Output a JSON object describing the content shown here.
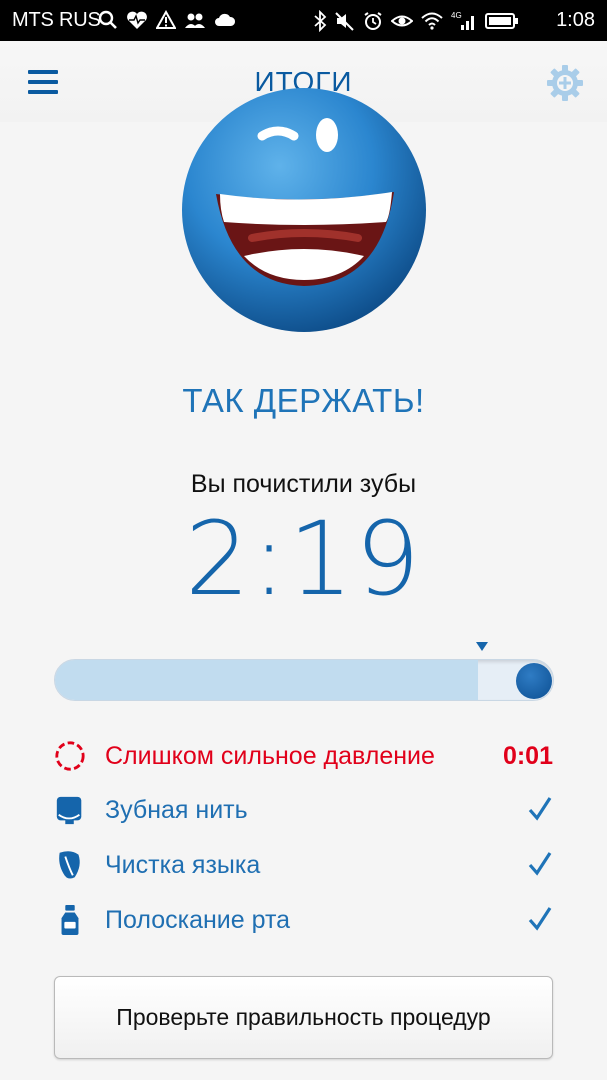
{
  "status_bar": {
    "carrier": "MTS RUS",
    "network_badge": "4G",
    "time": "1:08",
    "left_icons": [
      "search-icon",
      "heart-rate-icon",
      "warning-icon",
      "people-icon",
      "cloud-icon"
    ],
    "right_icons": [
      "bluetooth-icon",
      "mute-icon",
      "alarm-icon",
      "eye-icon",
      "wifi-icon",
      "signal-icon",
      "battery-icon"
    ]
  },
  "header": {
    "title": "ИТОГИ",
    "menu_icon": "hamburger-menu-icon",
    "settings_icon": "gear-add-icon"
  },
  "result": {
    "headline": "ТАК ДЕРЖАТЬ!",
    "subtext": "Вы почистили зубы",
    "time": "2:19",
    "progress_fraction": 0.85,
    "target_marker_fraction": 0.85
  },
  "checklist": [
    {
      "label": "Слишком сильное давление",
      "value": "0:01",
      "icon": "pressure-ring-icon",
      "done": false
    },
    {
      "label": "Зубная нить",
      "value": "",
      "icon": "floss-icon",
      "done": true
    },
    {
      "label": "Чистка языка",
      "value": "",
      "icon": "tongue-icon",
      "done": true
    },
    {
      "label": "Полоскание рта",
      "value": "",
      "icon": "mouthwash-bottle-icon",
      "done": true
    }
  ],
  "cta": {
    "label": "Проверьте правильность процедур"
  },
  "colors": {
    "brand_blue": "#1565ab",
    "accent_blue": "#1f74b8",
    "alert_red": "#e1001a",
    "progress_light": "#c1dcef",
    "background": "#f5f5f5"
  }
}
